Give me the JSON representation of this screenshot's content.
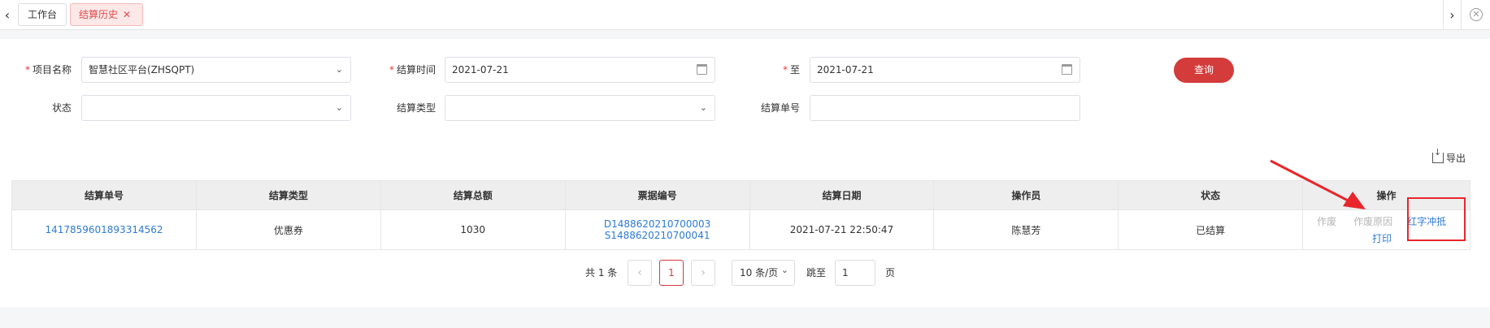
{
  "tabs": [
    {
      "label": "工作台"
    },
    {
      "label": "结算历史",
      "close": "✕"
    }
  ],
  "form": {
    "project_label": "项目名称",
    "project_value": "智慧社区平台(ZHSQPT)",
    "settle_time_label": "结算时间",
    "settle_time_from": "2021-07-21",
    "to_label": "至",
    "settle_time_to": "2021-07-21",
    "query_button": "查询",
    "status_label": "状态",
    "status_value": "",
    "type_label": "结算类型",
    "type_value": "",
    "number_label": "结算单号",
    "number_value": "",
    "required_mark": "*"
  },
  "toolbar": {
    "export_label": "导出"
  },
  "table": {
    "columns": [
      "结算单号",
      "结算类型",
      "结算总额",
      "票据编号",
      "结算日期",
      "操作员",
      "状态",
      "操作"
    ],
    "rows": [
      {
        "number": "1417859601893314562",
        "type": "优惠券",
        "total": "1030",
        "receipts": [
          "D1488620210700003",
          "S1488620210700041"
        ],
        "date": "2021-07-21 22:50:47",
        "operator": "陈慧芳",
        "status": "已结算",
        "ops": {
          "void": "作废",
          "void_reason": "作废原因",
          "red_offset": "红字冲抵",
          "print": "打印"
        }
      }
    ]
  },
  "pagination": {
    "total_text": "共 1 条",
    "prev": "‹",
    "current_page": "1",
    "next": "›",
    "page_size": "10 条/页",
    "jump_label": "跳至",
    "jump_value": "1",
    "page_suffix": "页"
  },
  "colors": {
    "accent": "#d43b3b",
    "link": "#2d7ad6",
    "annotation": "#e8262b"
  },
  "icons": {
    "tab_left": "chevron-left-icon",
    "tab_right": "chevron-right-icon",
    "close_all": "close-circle-icon",
    "calendar": "calendar-icon",
    "export": "download-icon",
    "dropdown": "chevron-down-icon"
  }
}
